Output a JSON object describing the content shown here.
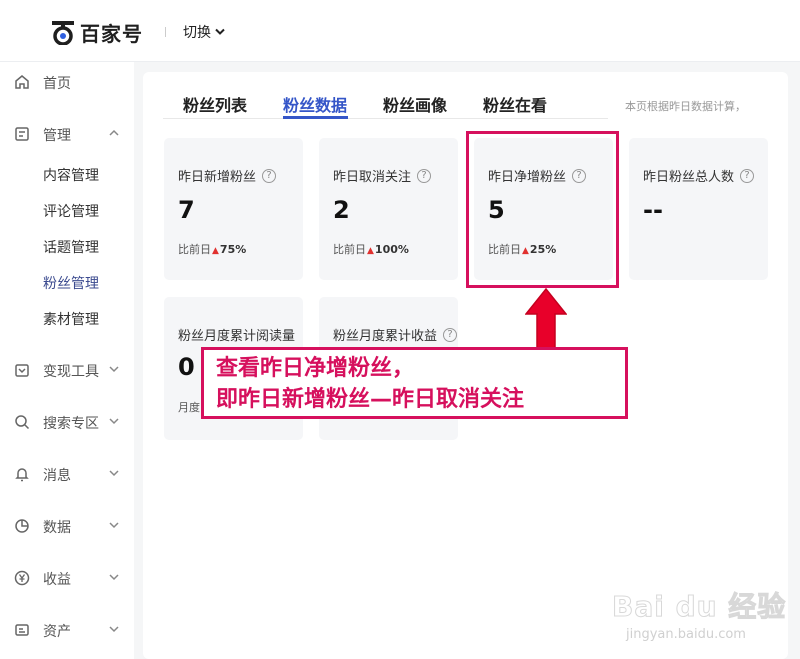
{
  "header": {
    "logo_text": "百家号",
    "switch_label": "切换"
  },
  "sidebar": {
    "items": [
      {
        "label": "首页",
        "icon": "home-icon"
      },
      {
        "label": "管理",
        "icon": "manage-icon",
        "expanded": true
      },
      {
        "label": "变现工具",
        "icon": "monetize-icon"
      },
      {
        "label": "搜索专区",
        "icon": "search-icon"
      },
      {
        "label": "消息",
        "icon": "bell-icon"
      },
      {
        "label": "数据",
        "icon": "pie-chart-icon"
      },
      {
        "label": "收益",
        "icon": "yen-icon"
      },
      {
        "label": "资产",
        "icon": "asset-icon"
      }
    ],
    "subitems": [
      "内容管理",
      "评论管理",
      "话题管理",
      "粉丝管理",
      "素材管理"
    ],
    "active_subitem": "粉丝管理"
  },
  "tabs": {
    "items": [
      "粉丝列表",
      "粉丝数据",
      "粉丝画像",
      "粉丝在看"
    ],
    "active": "粉丝数据",
    "note": "本页根据昨日数据计算，"
  },
  "cards": [
    {
      "title": "昨日新增粉丝",
      "value": "7",
      "compare_label": "比前日",
      "compare_value": "75%"
    },
    {
      "title": "昨日取消关注",
      "value": "2",
      "compare_label": "比前日",
      "compare_value": "100%"
    },
    {
      "title": "昨日净增粉丝",
      "value": "5",
      "compare_label": "比前日",
      "compare_value": "25%"
    },
    {
      "title": "昨日粉丝总人数",
      "value": "--"
    },
    {
      "title": "粉丝月度累计阅读量",
      "value": "0",
      "compare_label": "月度"
    },
    {
      "title": "粉丝月度累计收益"
    }
  ],
  "annotation": {
    "line1": "查看昨日净增粉丝，",
    "line2": "即昨日新增粉丝—昨日取消关注",
    "color": "#d6105d"
  },
  "watermark": {
    "brand": "Bai du 经验",
    "url": "jingyan.baidu.com"
  },
  "colors": {
    "accent": "#3556c8",
    "up": "#e0312f",
    "highlight": "#d6105d"
  }
}
